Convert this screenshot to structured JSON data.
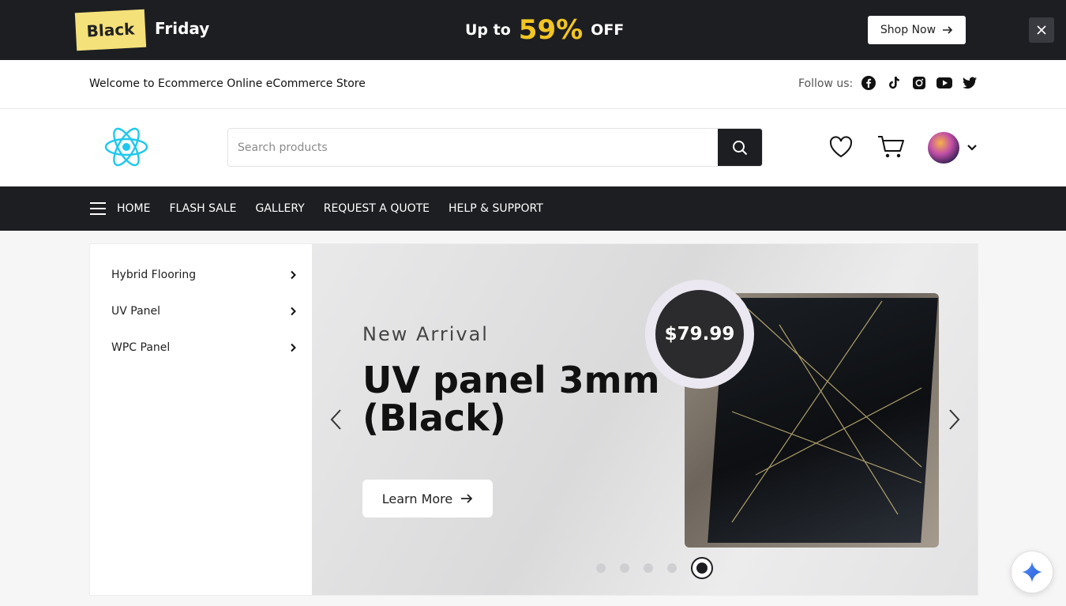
{
  "promo": {
    "badge": "Black",
    "badge_suffix": "Friday",
    "up_to": "Up to",
    "percent": "59%",
    "off": "OFF",
    "shop_label": "Shop Now",
    "close_icon": "close-icon"
  },
  "topbar": {
    "welcome": "Welcome to Ecommerce Online eCommerce Store",
    "follow_label": "Follow us:",
    "socials": [
      "facebook-icon",
      "tiktok-icon",
      "instagram-icon",
      "youtube-icon",
      "twitter-icon"
    ]
  },
  "header": {
    "logo_icon": "react-logo-icon",
    "search": {
      "placeholder": "Search products",
      "value": ""
    },
    "icons": [
      "heart-icon",
      "cart-icon",
      "avatar",
      "chevron-down-icon"
    ]
  },
  "nav": {
    "items": [
      "HOME",
      "FLASH SALE",
      "GALLERY",
      "REQUEST A QUOTE",
      "HELP & SUPPORT"
    ]
  },
  "sidebar": {
    "categories": [
      "Hybrid Flooring",
      "UV Panel",
      "WPC Panel"
    ]
  },
  "hero": {
    "kicker": "New Arrival",
    "title": "UV panel 3mm (Black)",
    "button": "Learn More",
    "price": "$79.99",
    "slide_count": 5,
    "active_slide": 5
  },
  "colors": {
    "dark": "#1d1e22",
    "accent_yellow": "#f2c522",
    "badge_yellow": "#f5e17a"
  }
}
